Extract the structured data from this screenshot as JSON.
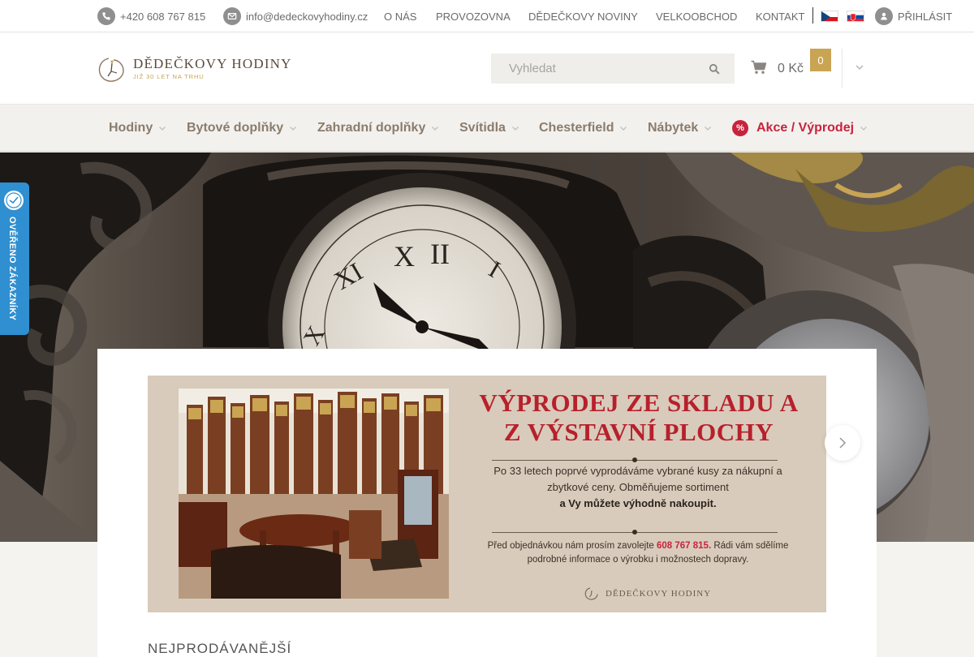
{
  "topbar": {
    "phone": "+420 608 767 815",
    "email": "info@dedeckovyhodiny.cz",
    "links": [
      "O NÁS",
      "PROVOZOVNA",
      "DĚDEČKOVY NOVINY",
      "VELKOOBCHOD",
      "KONTAKT"
    ],
    "login": "PŘIHLÁSIT",
    "languages": [
      "cz",
      "sk"
    ]
  },
  "header": {
    "logo_title": "DĚDEČKOVY HODINY",
    "logo_subtitle": "JIŽ 30 LET NA TRHU",
    "search_placeholder": "Vyhledat",
    "cart_amount": "0 Kč",
    "cart_count": "0"
  },
  "nav": {
    "items": [
      "Hodiny",
      "Bytové doplňky",
      "Zahradní doplňky",
      "Svítidla",
      "Chesterfield",
      "Nábytek"
    ],
    "sale_label": "Akce / Výprodej",
    "sale_icon_text": "%"
  },
  "badge": {
    "text": "OVĚŘENO ZÁKAZNÍKY"
  },
  "banner": {
    "title_line1": "VÝPRODEJ ZE SKLADU A",
    "title_line2": "Z VÝSTAVNÍ PLOCHY",
    "text_part1": "Po 33 letech poprvé vyprodáváme vybrané kusy za nákupní a zbytkové ceny. Obměňujeme sortiment",
    "text_bold": "a Vy můžete výhodně nakoupit.",
    "small_part1": "Před objednávkou nám prosím zavolejte",
    "small_phone": "608 767 815.",
    "small_part2": "Rádi vám sdělíme podrobné informace o výrobku i možnostech dopravy.",
    "footer_logo": "DĚDEČKOVY HODINY"
  },
  "section_title": "NEJPRODÁVANĚJŠÍ",
  "colors": {
    "accent_gold": "#c9a453",
    "sale_red": "#c8233c",
    "badge_blue": "#2f8fd0",
    "nav_text": "#8a7c6d"
  }
}
